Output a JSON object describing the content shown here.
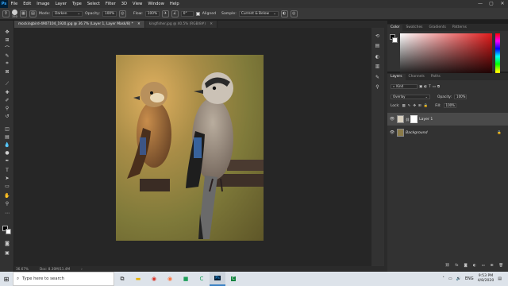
{
  "app": {
    "logo": "Ps",
    "menu": [
      "File",
      "Edit",
      "Image",
      "Layer",
      "Type",
      "Select",
      "Filter",
      "3D",
      "View",
      "Window",
      "Help"
    ],
    "window_controls": [
      "—",
      "▢",
      "✕"
    ]
  },
  "options_bar": {
    "brush_size": "350",
    "mode_label": "Mode:",
    "mode_value": "Darken",
    "opacity_label": "Opacity:",
    "opacity_value": "100%",
    "flow_label": "Flow:",
    "flow_value": "100%",
    "angle_value": "0°",
    "aligned_label": "Aligned",
    "sample_label": "Sample:",
    "sample_value": "Current & Below"
  },
  "document_tabs": [
    {
      "label": "mockingbird-4907104_1920.jpg @ 36.7% (Layer 1, Layer Mask/8) *",
      "active": true
    },
    {
      "label": "kingfisher.jpg @ 40.5% (RGB/8#)",
      "active": false
    }
  ],
  "status_bar": {
    "zoom": "36.67%",
    "doc_info": "Doc: 8.30M/11.4M"
  },
  "color_panel": {
    "tabs": [
      "Color",
      "Swatches",
      "Gradients",
      "Patterns"
    ],
    "active_tab": "Color",
    "foreground": "#000000",
    "background": "#ffffff",
    "hue": "#e11a1a"
  },
  "layers_panel": {
    "tabs": [
      "Layers",
      "Channels",
      "Paths"
    ],
    "active_tab": "Layers",
    "filter_label": "Kind",
    "blend_mode": "Overlay",
    "opacity_label": "Opacity:",
    "opacity_value": "100%",
    "lock_label": "Lock:",
    "fill_label": "Fill:",
    "fill_value": "100%",
    "layers": [
      {
        "name": "Layer 1",
        "selected": true,
        "has_mask": true
      },
      {
        "name": "Background",
        "selected": false,
        "locked": true
      }
    ],
    "footer_icons": [
      "link-icon",
      "fx-icon",
      "mask-icon",
      "adjustment-icon",
      "folder-icon",
      "new-layer-icon",
      "trash-icon"
    ]
  },
  "taskbar": {
    "search_placeholder": "Type here to search",
    "apps": [
      "task-view-icon",
      "file-explorer-icon",
      "chrome-icon",
      "firefox-icon",
      "green-app-icon",
      "camtasia-icon",
      "photoshop-icon",
      "camtasia-recorder-icon"
    ],
    "language": "ENG",
    "time": "9:53 PM",
    "date": "4/8/2020"
  }
}
